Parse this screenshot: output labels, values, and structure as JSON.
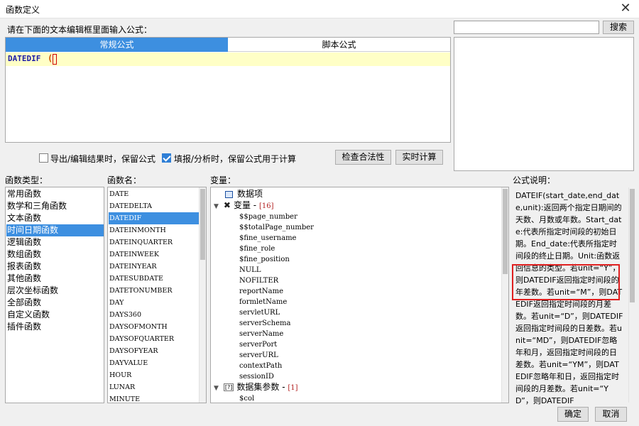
{
  "window": {
    "title": "函数定义",
    "close_glyph": "✕"
  },
  "instruction": "请在下面的文本编辑框里面输入公式：",
  "search": {
    "value": "",
    "button": "搜索"
  },
  "tabs": [
    "常规公式",
    "脚本公式"
  ],
  "formula": {
    "function": "DATEDIF",
    "paren": "("
  },
  "options": {
    "export_keep": {
      "label": "导出/编辑结果时，保留公式",
      "checked": false
    },
    "fill_keep": {
      "label": "填报/分析时，保留公式用于计算",
      "checked": true
    }
  },
  "buttons": {
    "check": "检查合法性",
    "realtime": "实时计算",
    "ok": "确定",
    "cancel": "取消"
  },
  "labels": {
    "category": "函数类型：",
    "fname": "函数名：",
    "variable": "变量：",
    "desc": "公式说明："
  },
  "categories": [
    {
      "label": "常用函数"
    },
    {
      "label": "数学和三角函数"
    },
    {
      "label": "文本函数"
    },
    {
      "label": "时间日期函数",
      "selected": true
    },
    {
      "label": "逻辑函数"
    },
    {
      "label": "数组函数"
    },
    {
      "label": "报表函数"
    },
    {
      "label": "其他函数"
    },
    {
      "label": "层次坐标函数"
    },
    {
      "label": "全部函数"
    },
    {
      "label": "自定义函数"
    },
    {
      "label": "插件函数"
    }
  ],
  "functions": [
    {
      "label": "DATE"
    },
    {
      "label": "DATEDELTA"
    },
    {
      "label": "DATEDIF",
      "selected": true
    },
    {
      "label": "DATEINMONTH"
    },
    {
      "label": "DATEINQUARTER"
    },
    {
      "label": "DATEINWEEK"
    },
    {
      "label": "DATEINYEAR"
    },
    {
      "label": "DATESUBDATE"
    },
    {
      "label": "DATETONUMBER"
    },
    {
      "label": "DAY"
    },
    {
      "label": "DAYS360"
    },
    {
      "label": "DAYSOFMONTH"
    },
    {
      "label": "DAYSOFQUARTER"
    },
    {
      "label": "DAYSOFYEAR"
    },
    {
      "label": "DAYVALUE"
    },
    {
      "label": "HOUR"
    },
    {
      "label": "LUNAR"
    },
    {
      "label": "MINUTE"
    }
  ],
  "variables": {
    "dataitem": "数据项",
    "vars_group": {
      "label": "变量 - ",
      "count": "[16]"
    },
    "vars": [
      "$$page_number",
      "$$totalPage_number",
      "$fine_username",
      "$fine_role",
      "$fine_position",
      "NULL",
      "NOFILTER",
      "reportName",
      "formletName",
      "servletURL",
      "serverSchema",
      "serverName",
      "serverPort",
      "serverURL",
      "contextPath",
      "sessionID"
    ],
    "ds_group": {
      "label": "数据集参数 - ",
      "count": "[1]"
    },
    "ds_params": [
      "$col"
    ]
  },
  "description": "DATEIF(start_date,end_date,unit):返回两个指定日期间的天数、月数或年数。Start_date:代表所指定时间段的初始日期。End_date:代表所指定时间段的终止日期。Unit:函数返回信息的类型。若unit=“Y”，则DATEDIF返回指定时间段的年差数。若unit=“M”，则DATEDIF返回指定时间段的月差数。若unit=“D”，则DATEDIF返回指定时间段的日差数。若unit=“MD”，则DATEDIF忽略年和月，返回指定时间段的日差数。若unit=“YM”，则DATEDIF忽略年和日，返回指定时间段的月差数。若unit=“YD”，则DATEDIF"
}
